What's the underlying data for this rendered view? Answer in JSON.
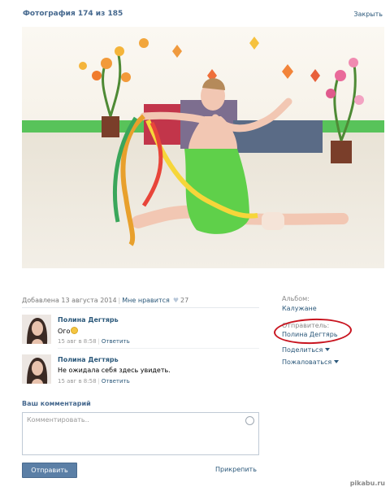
{
  "header": {
    "title": "Фотография 174 из 185",
    "close": "Закрыть"
  },
  "meta": {
    "added": "Добавлена 13 августа 2014",
    "like_label": "Мне нравится",
    "like_count": "27"
  },
  "comments": [
    {
      "author": "Полина Дегтярь",
      "text": "Ого",
      "date": "15 авг в 8:58",
      "reply": "Ответить"
    },
    {
      "author": "Полина Дегтярь",
      "text": "Не ожидала себя здесь увидеть.",
      "date": "15 авг в 8:58",
      "reply": "Ответить"
    }
  ],
  "composer": {
    "title": "Ваш комментарий",
    "placeholder": "Комментировать..",
    "send": "Отправить",
    "attach": "Прикрепить"
  },
  "sidebar": {
    "album_label": "Альбом:",
    "album_value": "Калужане",
    "sender_label": "Отправитель:",
    "sender_value": "Полина Дегтярь",
    "share": "Поделиться",
    "report": "Пожаловаться"
  },
  "watermark": "pikabu.ru",
  "colors": {
    "link": "#2b587a",
    "header": "#45688e",
    "button": "#5b7fa6",
    "annotation": "#c8141f"
  }
}
